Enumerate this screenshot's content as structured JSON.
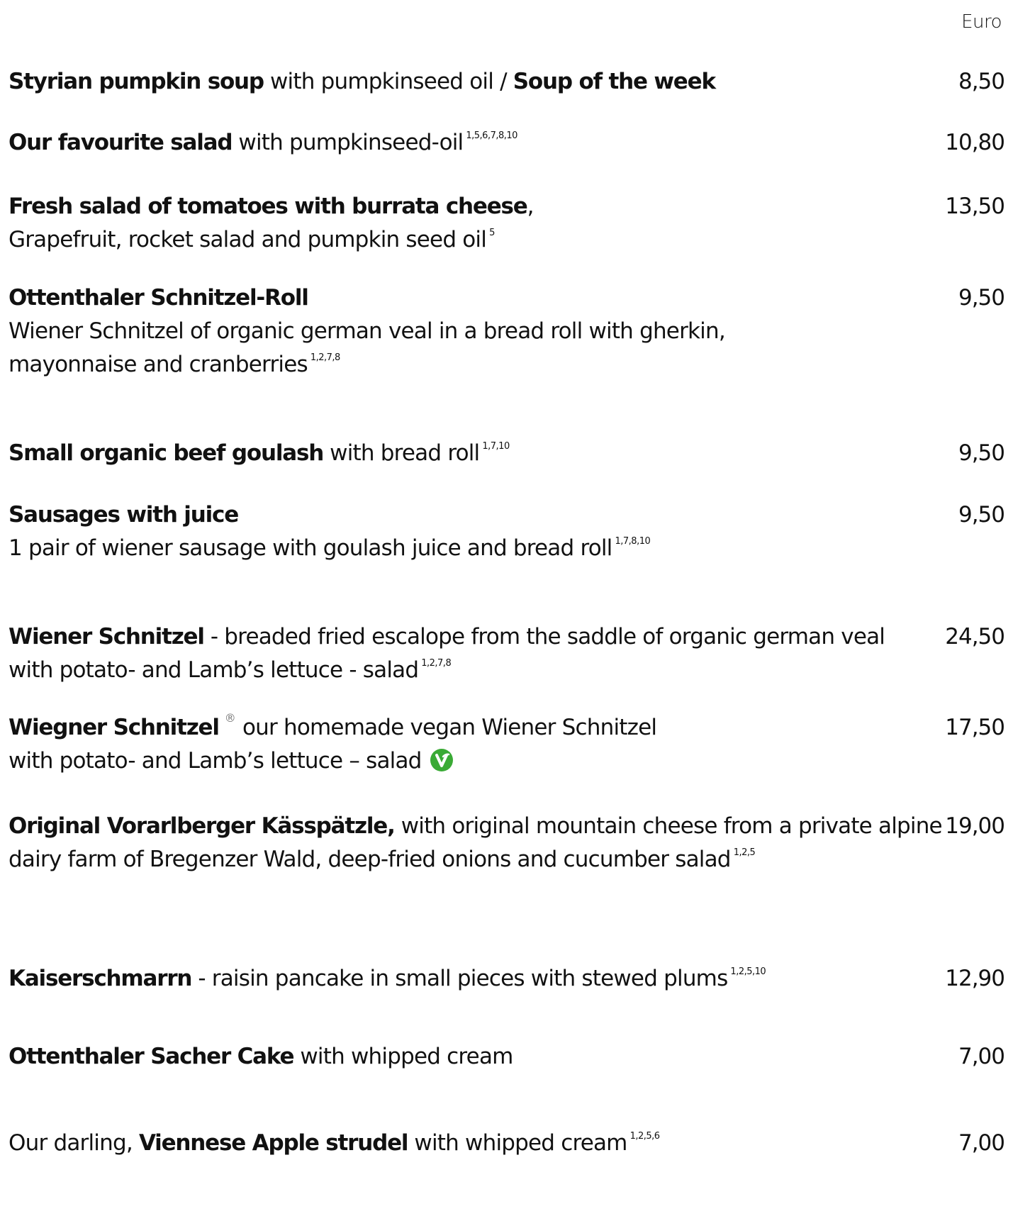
{
  "currency_label": "Euro",
  "items": [
    {
      "name": "Styrian pumpkin soup",
      "desc": " with pumpkinseed oil / ",
      "name2": "Soup of the week",
      "price": "8,50"
    },
    {
      "name": "Our favourite salad",
      "desc": " with pumpkinseed-oil",
      "allergens": "1,5,6,7,8,10",
      "price": "10,80"
    },
    {
      "name": "Fresh salad of tomatoes with burrata cheese",
      "desc": ",",
      "line2": "Grapefruit, rocket salad and pumpkin seed oil",
      "allergens": "5",
      "price": "13,50"
    },
    {
      "name": "Ottenthaler Schnitzel-Roll",
      "line2": "Wiener Schnitzel of organic german veal in a bread roll with gherkin, mayonnaise and cranberries",
      "allergens": "1,2,7,8",
      "price": "9,50"
    },
    {
      "name": "Small organic beef goulash",
      "desc": " with bread roll",
      "allergens": "1,7,10",
      "price": "9,50"
    },
    {
      "name": "Sausages with juice",
      "line2": "1 pair of wiener sausage with goulash juice and bread roll",
      "allergens": "1,7,8,10",
      "price": "9,50"
    },
    {
      "name": "Wiener Schnitzel",
      "desc": " - breaded fried escalope from the saddle of organic german veal",
      "line2": "with potato- and Lamb’s lettuce - salad",
      "allergens": "1,2,7,8",
      "price": "24,50"
    },
    {
      "name": "Wiegner Schnitzel",
      "registered": "®",
      "desc": "our homemade vegan Wiener Schnitzel",
      "line2": "with potato- and Lamb’s lettuce – salad",
      "vegan_icon": "vegan-leaf-icon",
      "vegan_color": "#3aaa35",
      "price": "17,50"
    },
    {
      "name": "Original Vorarlberger Kässpätzle,",
      "desc": " with original mountain cheese from a private alpine",
      "line2": "dairy farm of Bregenzer Wald, deep-fried onions and cucumber salad",
      "allergens": "1,2,5",
      "price": "19,00"
    },
    {
      "name": "Kaiserschmarrn",
      "desc": " - raisin pancake in small pieces with stewed plums",
      "allergens": "1,2,5,10",
      "price": "12,90"
    },
    {
      "name": "Ottenthaler Sacher Cake",
      "desc": " with whipped cream",
      "price": "7,00"
    },
    {
      "prefix": "Our darling, ",
      "name": "Viennese Apple strudel",
      "desc": " with whipped cream",
      "allergens": "1,2,5,6",
      "price": "7,00"
    }
  ]
}
